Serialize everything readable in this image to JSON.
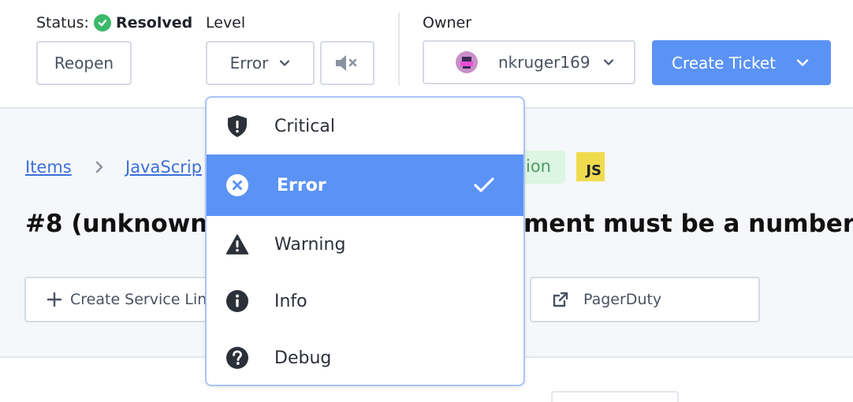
{
  "header": {
    "status_label": "Status:",
    "status_value": "Resolved",
    "reopen_label": "Reopen",
    "level_label": "Level",
    "level_value": "Error",
    "owner_label": "Owner",
    "owner_value": "nkruger169",
    "create_ticket_label": "Create Ticket"
  },
  "breadcrumb": {
    "items_label": "Items",
    "project_label": "JavaScrip",
    "env_tail": "ion",
    "lang_badge": "JS"
  },
  "item": {
    "title_left": "#8 (unknown)",
    "title_right": "ment must be a number"
  },
  "actions": {
    "create_service_link_label": "Create Service Lin",
    "pagerduty_label": "PagerDuty"
  },
  "level_menu": {
    "selected": "Error",
    "options": [
      {
        "label": "Critical",
        "icon": "shield-alert-icon"
      },
      {
        "label": "Error",
        "icon": "x-circle-icon"
      },
      {
        "label": "Warning",
        "icon": "warning-triangle-icon"
      },
      {
        "label": "Info",
        "icon": "info-circle-icon"
      },
      {
        "label": "Debug",
        "icon": "question-circle-icon"
      }
    ]
  },
  "colors": {
    "accent": "#5b93f5",
    "resolved_green": "#3db86b",
    "js_yellow": "#f0db4f"
  }
}
